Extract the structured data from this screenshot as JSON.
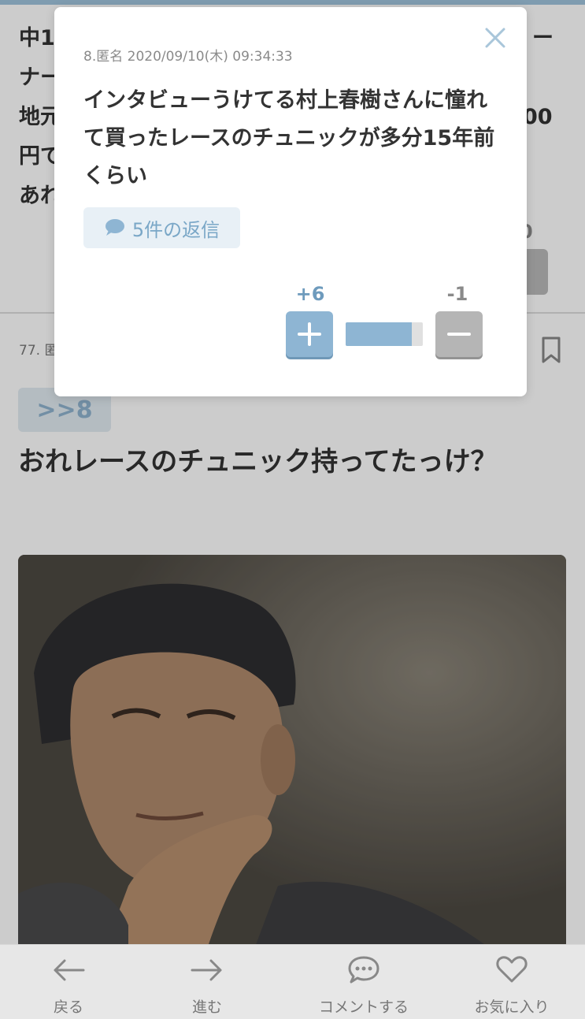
{
  "background_comment": {
    "lines": [
      "中1",
      "ナー",
      "地元",
      "円で",
      "あれ"
    ],
    "right_fragments": [
      "ー",
      "00"
    ],
    "vote_count": "0"
  },
  "comment77": {
    "meta": "77. 匿",
    "anchor": ">>8",
    "body": "おれレースのチュニック持ってたっけ？"
  },
  "modal": {
    "meta": "8.匿名 2020/09/10(木) 09:34:33",
    "body": "インタビューうけてる村上春樹さんに憧れて買ったレースのチュニックが多分15年前くらい",
    "reply_label": "5件の返信",
    "plus_count": "+6",
    "minus_count": "-1",
    "vote_ratio": 0.857
  },
  "bottom_nav": {
    "back": "戻る",
    "forward": "進む",
    "comment": "コメントする",
    "favorite": "お気に入り"
  },
  "colors": {
    "accent": "#8eb5d3",
    "accent_text": "#6e9bbd",
    "minus": "#b5b5b5",
    "nav_bg": "#e7e7e7"
  }
}
